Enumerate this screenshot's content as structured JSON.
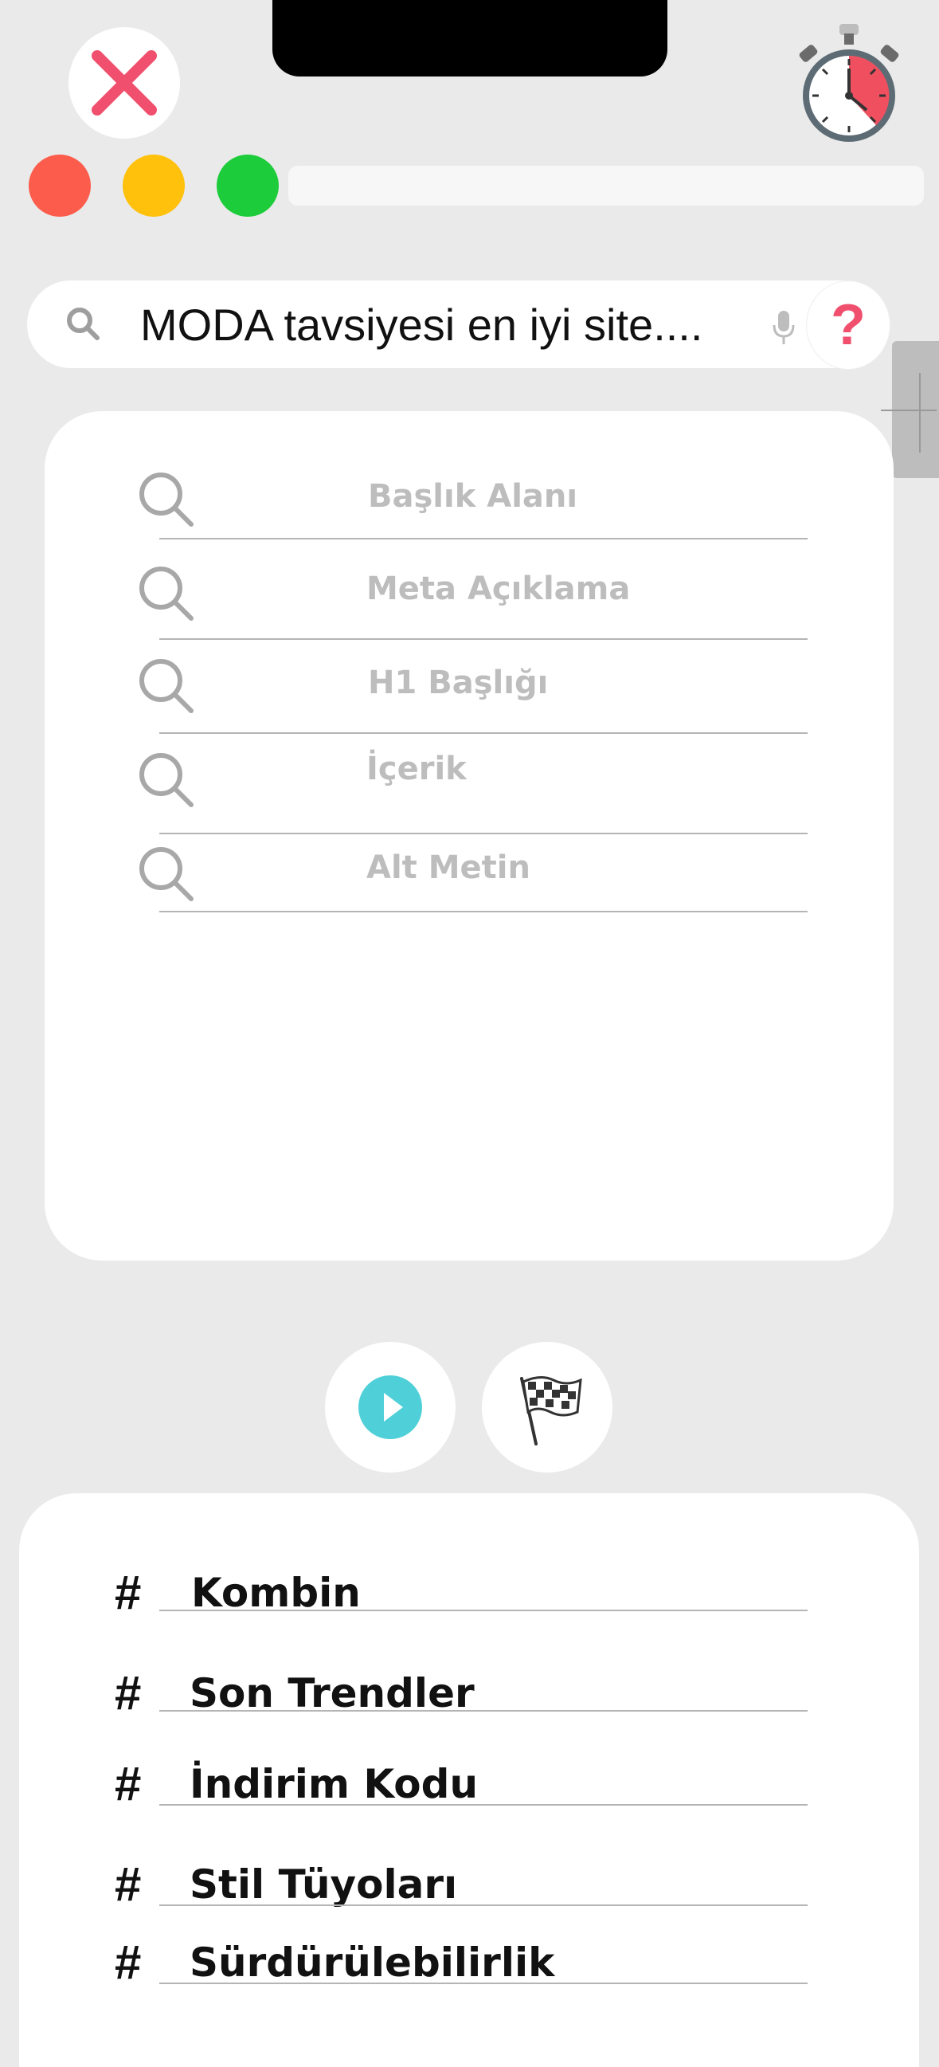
{
  "search": {
    "query": "MODA tavsiyesi en iyi site...."
  },
  "help": {
    "label": "?"
  },
  "seo_fields": [
    {
      "label": "Başlık Alanı"
    },
    {
      "label": "Meta Açıklama"
    },
    {
      "label": "H1 Başlığı"
    },
    {
      "label": "İçerik"
    },
    {
      "label": "Alt Metin"
    }
  ],
  "hashtags": [
    {
      "hash": "#",
      "label": "Kombin"
    },
    {
      "hash": "#",
      "label": "Son Trendler"
    },
    {
      "hash": "#",
      "label": "İndirim Kodu"
    },
    {
      "hash": "#",
      "label": "Stil Tüyoları"
    },
    {
      "hash": "#",
      "label": "Sürdürülebilirlik"
    }
  ],
  "colors": {
    "close": "#f0506e",
    "play": "#4fd0d8",
    "traffic_red": "#fc5c4b",
    "traffic_yellow": "#ffc10b",
    "traffic_green": "#1ccc3a"
  },
  "icons": {
    "close": "close-icon",
    "timer": "stopwatch-icon",
    "search": "search-icon",
    "mic": "microphone-icon",
    "play": "play-icon",
    "flag": "checkered-flag-icon"
  }
}
